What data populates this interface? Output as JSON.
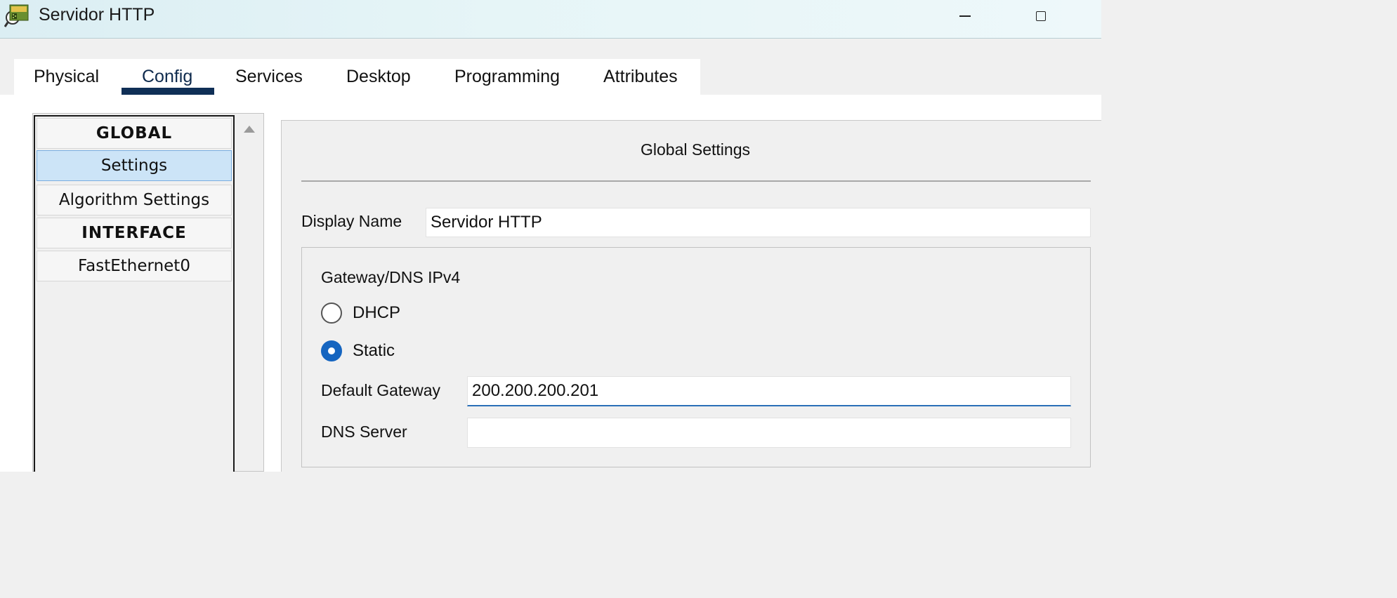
{
  "window": {
    "title": "Servidor HTTP",
    "icon": "packet-tracer-server-icon",
    "controls": [
      "minimize-icon",
      "maximize-icon"
    ]
  },
  "tabs": [
    {
      "label": "Physical",
      "active": false
    },
    {
      "label": "Config",
      "active": true
    },
    {
      "label": "Services",
      "active": false
    },
    {
      "label": "Desktop",
      "active": false
    },
    {
      "label": "Programming",
      "active": false
    },
    {
      "label": "Attributes",
      "active": false
    }
  ],
  "sidebar": {
    "items": [
      {
        "label": "GLOBAL",
        "type": "header"
      },
      {
        "label": "Settings",
        "type": "item",
        "selected": true
      },
      {
        "label": "Algorithm Settings",
        "type": "item"
      },
      {
        "label": "INTERFACE",
        "type": "header"
      },
      {
        "label": "FastEthernet0",
        "type": "item"
      }
    ]
  },
  "global_settings": {
    "title": "Global Settings",
    "display_name_label": "Display Name",
    "display_name_value": "Servidor HTTP",
    "gateway_group": {
      "title": "Gateway/DNS IPv4",
      "dhcp_label": "DHCP",
      "static_label": "Static",
      "selected_mode": "Static",
      "default_gateway_label": "Default Gateway",
      "default_gateway_value": "200.200.200.201",
      "dns_server_label": "DNS Server",
      "dns_server_value": ""
    }
  },
  "colors": {
    "accent": "#0f2f56",
    "selection": "#cce4f7",
    "radio_selected": "#1565c0",
    "focus_underline": "#2a6fb8"
  }
}
